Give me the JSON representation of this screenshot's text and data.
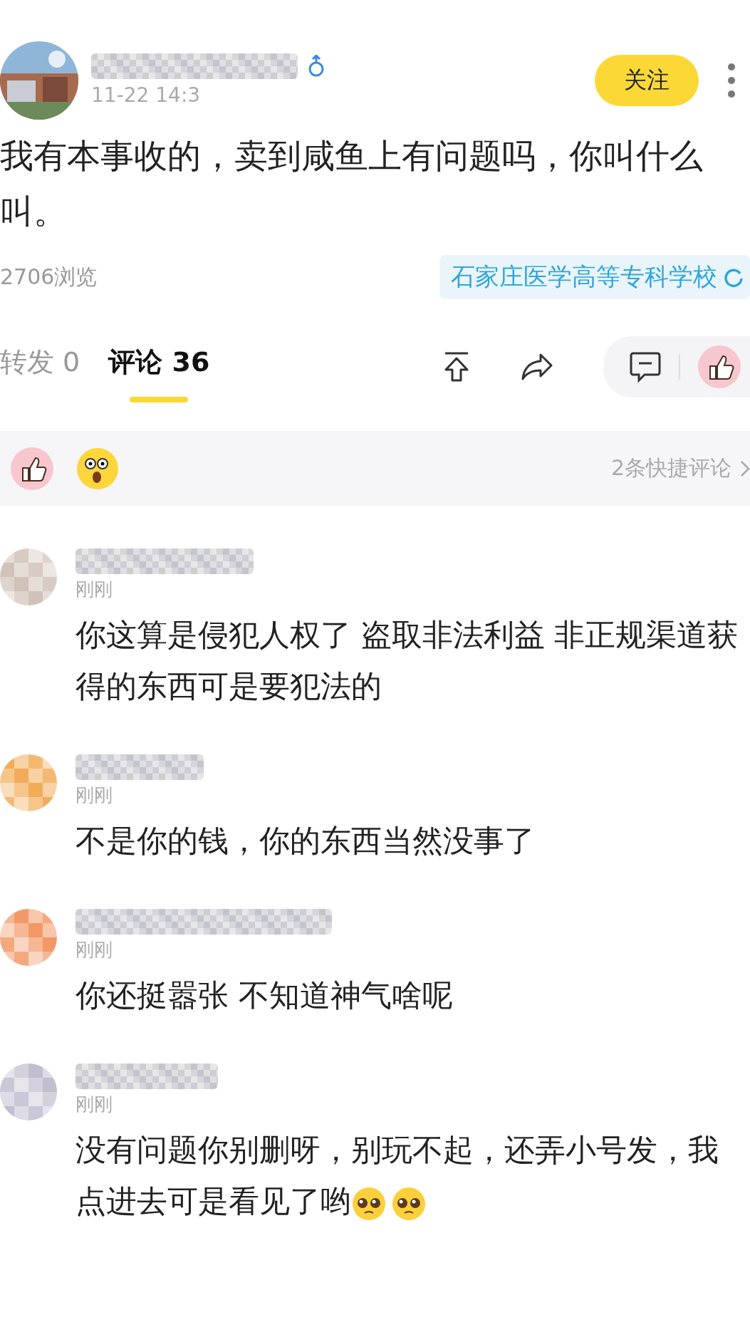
{
  "post": {
    "time": "11-22 14:3",
    "follow_label": "关注",
    "text": "我有本事收的，卖到咸鱼上有问题吗，你叫什么叫。",
    "views": "2706浏览",
    "school": "石家庄医学高等专科学校"
  },
  "tabs": [
    {
      "label": "转发 0",
      "selected": false
    },
    {
      "label": "评论 36",
      "selected": true
    }
  ],
  "quick_comments": {
    "reactions": [
      {
        "kind": "thumbs"
      },
      {
        "kind": "shocked"
      }
    ],
    "summary": "2条快捷评论"
  },
  "comments": [
    {
      "time": "刚刚",
      "text": "你这算是侵犯人权了 盗取非法利益 非正规渠道获得的东西可是要犯法的"
    },
    {
      "time": "刚刚",
      "text": "不是你的钱，你的东西当然没事了"
    },
    {
      "time": "刚刚",
      "text": "你还挺嚣张 不知道神气啥呢"
    },
    {
      "time": "刚刚",
      "text": "没有问题你别删呀，别玩不起，还弄小号发，我点进去可是看见了哟",
      "emojis": [
        {
          "kind": "pleading"
        },
        {
          "kind": "pleading"
        }
      ]
    }
  ]
}
